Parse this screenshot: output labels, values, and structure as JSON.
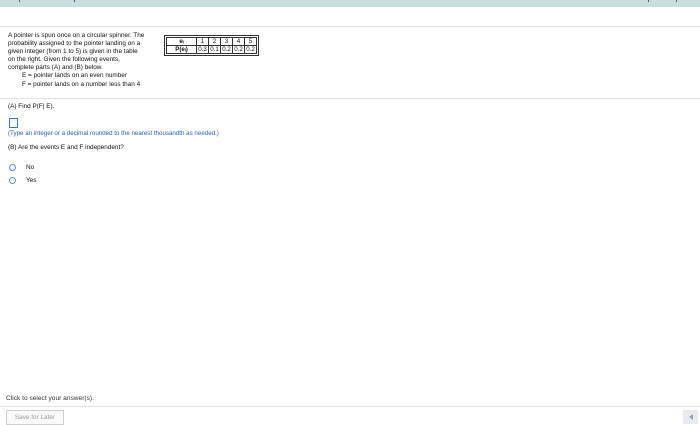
{
  "problem": {
    "lines": [
      "A pointer is spun once on a circular spinner.  The",
      "probability assigned to the pointer landing on a",
      "given integer (from 1 to 5) is given in the table",
      "on the right. Given the following events,",
      "complete parts (A) and (B) below."
    ],
    "event_e": "E  =  pointer lands on an even number",
    "event_f": "F  =  pointer lands on a number less than 4"
  },
  "table": {
    "header_label": "eᵢ",
    "prob_label": "P(eᵢ)",
    "outcomes": [
      "1",
      "2",
      "3",
      "4",
      "5"
    ],
    "probabilities": [
      "0.3",
      "0.1",
      "0.2",
      "0.2",
      "0.2"
    ]
  },
  "part_a": {
    "question": "(A) Find P(F| E).",
    "hint": "(Type an integer or a decimal rounded to the nearest thousandth as needed.)"
  },
  "part_b": {
    "question": "(B) Are the events E and F independent?",
    "options": [
      "No",
      "Yes"
    ]
  },
  "footer": {
    "click_note": "Click to select your answer(s).",
    "save_label": "Save for Later"
  }
}
